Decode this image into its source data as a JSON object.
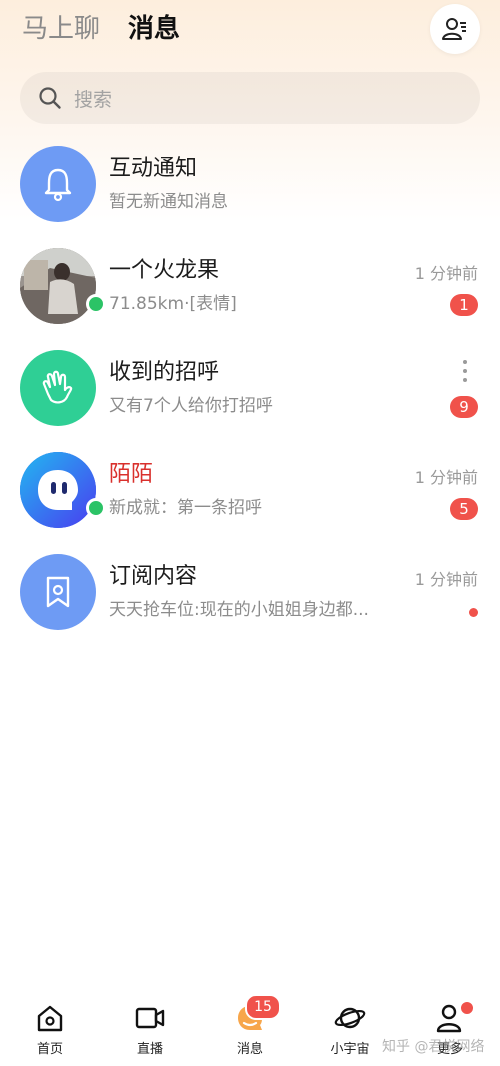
{
  "header": {
    "tab_inactive": "马上聊",
    "tab_active": "消息",
    "contacts_icon": "contacts-icon"
  },
  "search": {
    "placeholder": "搜索",
    "icon": "search-icon"
  },
  "conversations": [
    {
      "title": "互动通知",
      "subtitle": "暂无新通知消息",
      "time": "",
      "badge": "",
      "avatar_icon": "bell-icon",
      "avatar_color": "#6e9bf4"
    },
    {
      "title": "一个火龙果",
      "subtitle": "71.85km·[表情]",
      "time": "1 分钟前",
      "badge": "1",
      "online": true,
      "avatar_icon": "photo-avatar"
    },
    {
      "title": "收到的招呼",
      "subtitle": "又有7个人给你打招呼",
      "time": "",
      "badge": "9",
      "avatar_icon": "wave-hand-icon",
      "avatar_color": "#2fcf95"
    },
    {
      "title": "陌陌",
      "subtitle": "新成就：第一条招呼",
      "time": "1 分钟前",
      "badge": "5",
      "online": true,
      "title_color": "#d9302c",
      "avatar_icon": "momo-logo",
      "avatar_color": "#3a5bf0"
    },
    {
      "title": "订阅内容",
      "subtitle": "天天抢车位:现在的小姐姐身边都...",
      "time": "1 分钟前",
      "badge_dot": true,
      "avatar_icon": "bookmark-icon",
      "avatar_color": "#6e9bf4"
    }
  ],
  "nav": [
    {
      "label": "首页",
      "icon": "home-icon"
    },
    {
      "label": "直播",
      "icon": "video-icon"
    },
    {
      "label": "消息",
      "icon": "message-icon",
      "badge": "15"
    },
    {
      "label": "小宇宙",
      "icon": "planet-icon"
    },
    {
      "label": "更多",
      "icon": "user-icon",
      "dot": true
    }
  ],
  "watermark": "知乎 @君悦网络"
}
